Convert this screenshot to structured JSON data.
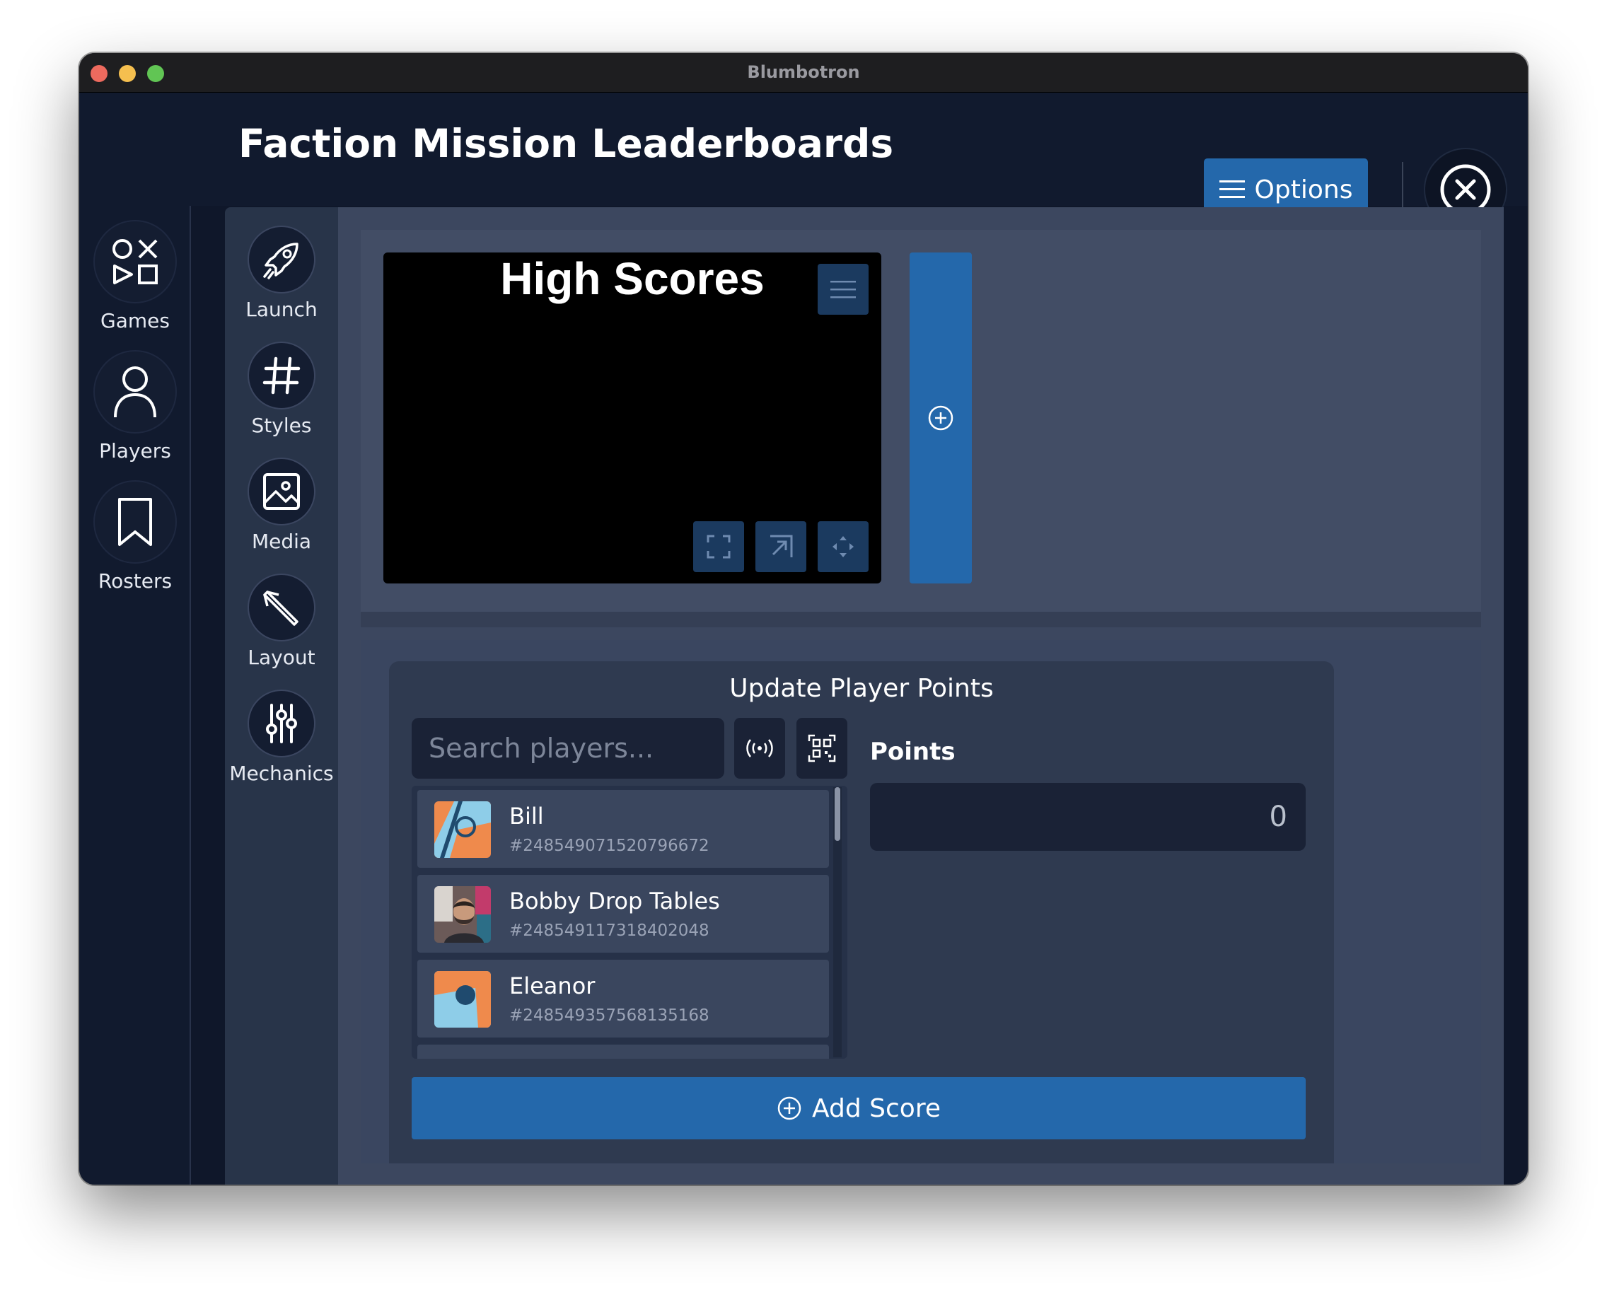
{
  "window": {
    "title": "Blumbotron"
  },
  "header": {
    "title": "Faction Mission Leaderboards",
    "options_label": "Options"
  },
  "nav_primary": {
    "items": [
      {
        "label": "Games",
        "icon": "games-icon"
      },
      {
        "label": "Players",
        "icon": "person-icon"
      },
      {
        "label": "Rosters",
        "icon": "bookmark-icon"
      }
    ]
  },
  "nav_secondary": {
    "items": [
      {
        "label": "Launch",
        "icon": "rocket-icon"
      },
      {
        "label": "Styles",
        "icon": "hash-icon"
      },
      {
        "label": "Media",
        "icon": "image-icon"
      },
      {
        "label": "Layout",
        "icon": "pen-icon"
      },
      {
        "label": "Mechanics",
        "icon": "sliders-icon"
      }
    ]
  },
  "preview": {
    "title": "High Scores"
  },
  "update": {
    "title": "Update Player Points",
    "search_placeholder": "Search players...",
    "points_label": "Points",
    "points_value": "0",
    "add_score_label": "Add Score",
    "players": [
      {
        "name": "Bill",
        "id": "#248549071520796672"
      },
      {
        "name": "Bobby Drop Tables",
        "id": "#248549117318402048"
      },
      {
        "name": "Eleanor",
        "id": "#248549357568135168"
      }
    ]
  },
  "colors": {
    "accent": "#2468ab",
    "header_bg": "#111a2e",
    "main_bg": "#3c475f"
  }
}
